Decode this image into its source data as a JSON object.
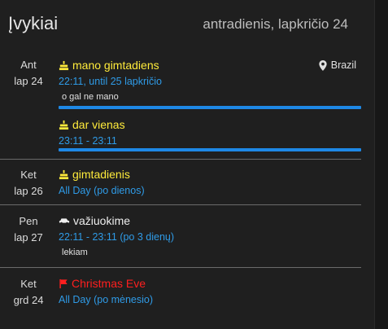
{
  "header": {
    "title": "Įvykiai",
    "date": "antradienis, lapkričio 24"
  },
  "days": [
    {
      "weekday": "Ant",
      "date": "lap 24",
      "events": [
        {
          "title": "mano gimtadiens",
          "time": "22:11, until 25 lapkričio",
          "description": "o gal ne mano",
          "location": "Brazil",
          "icon": "cake-icon"
        },
        {
          "title": "dar vienas",
          "time": "23:11 - 23:11",
          "icon": "cake-icon"
        }
      ]
    },
    {
      "weekday": "Ket",
      "date": "lap 26",
      "events": [
        {
          "title": "gimtadienis",
          "time": "All Day",
          "recurrence": "(po dienos)",
          "icon": "cake-icon"
        }
      ]
    },
    {
      "weekday": "Pen",
      "date": "lap 27",
      "events": [
        {
          "title": "važiuokime",
          "time": "22:11 - 23:11",
          "recurrence": "(po 3 dienų)",
          "description": "lekiam",
          "icon": "car-icon"
        }
      ]
    },
    {
      "weekday": "Ket",
      "date": "grd 24",
      "events": [
        {
          "title": "Christmas Eve",
          "time": "All Day",
          "recurrence": "(po mėnesio)",
          "icon": "flag-icon"
        }
      ]
    }
  ],
  "colors": {
    "accent": "#1e88e5",
    "time": "#2f9be7",
    "birthday": "#ffeb3b",
    "holiday": "#ff1f1f",
    "background": "#1f1f1f"
  }
}
